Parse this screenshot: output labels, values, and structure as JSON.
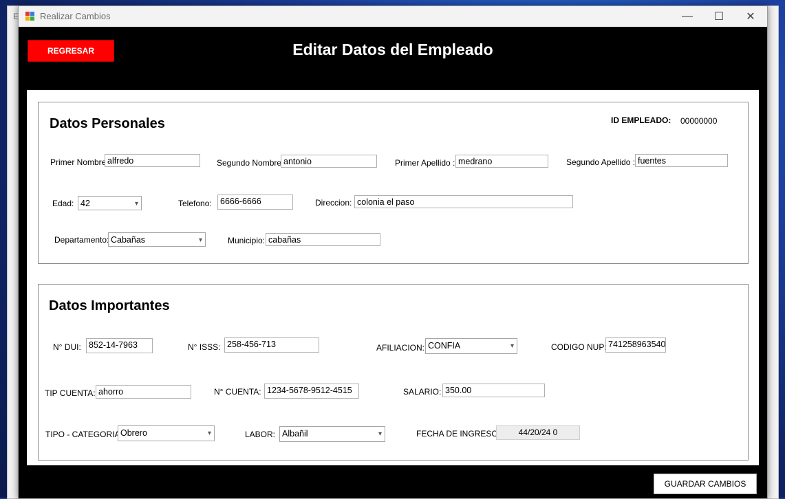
{
  "background_window": {
    "title_fragment": "Ec"
  },
  "window": {
    "title": "Realizar Cambios",
    "controls": {
      "minimize": "—",
      "maximize": "☐",
      "close": "✕"
    }
  },
  "header": {
    "back_label": "REGRESAR",
    "title": "Editar Datos del Empleado"
  },
  "personal": {
    "title": "Datos Personales",
    "id_label": "ID EMPLEADO:",
    "id_value": "00000000",
    "primer_nombre": {
      "label": "Primer Nombre:",
      "value": "alfredo"
    },
    "segundo_nombre": {
      "label": "Segundo Nombre:",
      "value": "antonio"
    },
    "primer_apellido": {
      "label": "Primer Apellido :",
      "value": "medrano"
    },
    "segundo_apellido": {
      "label": "Segundo Apellido :",
      "value": "fuentes"
    },
    "edad": {
      "label": "Edad:",
      "value": "42"
    },
    "telefono": {
      "label": "Telefono:",
      "value": "6666-6666"
    },
    "direccion": {
      "label": "Direccion:",
      "value": "colonia el paso"
    },
    "departamento": {
      "label": "Departamento:",
      "value": "Cabañas"
    },
    "municipio": {
      "label": "Municipio:",
      "value": "cabañas"
    }
  },
  "importantes": {
    "title": "Datos Importantes",
    "dui": {
      "label": "N° DUI:",
      "value": "852-14-7963"
    },
    "isss": {
      "label": "N° ISSS:",
      "value": "258-456-713"
    },
    "afiliacion": {
      "label": "AFILIACION:",
      "value": "CONFIA"
    },
    "nup": {
      "label": "CODIGO NUP:",
      "value": "741258963540"
    },
    "tip_cuenta": {
      "label": "TIP CUENTA:",
      "value": "ahorro"
    },
    "cuenta": {
      "label": "N° CUENTA:",
      "value": "1234-5678-9512-4515"
    },
    "salario": {
      "label": "SALARIO:",
      "value": "350.00"
    },
    "categoria": {
      "label": "TIPO - CATEGORIA:",
      "value": "Obrero"
    },
    "labor": {
      "label": "LABOR:",
      "value": "Albañil"
    },
    "fecha": {
      "label": "FECHA DE INGRESO:",
      "value": "44/20/24 0"
    }
  },
  "footer": {
    "save_label": "GUARDAR CAMBIOS"
  },
  "colors": {
    "accent_red": "#ff0000",
    "window_bg": "#000000",
    "panel_bg": "#ffffff"
  },
  "icons": {
    "dropdown": "chevron-down-icon",
    "app": "app-form-icon"
  }
}
